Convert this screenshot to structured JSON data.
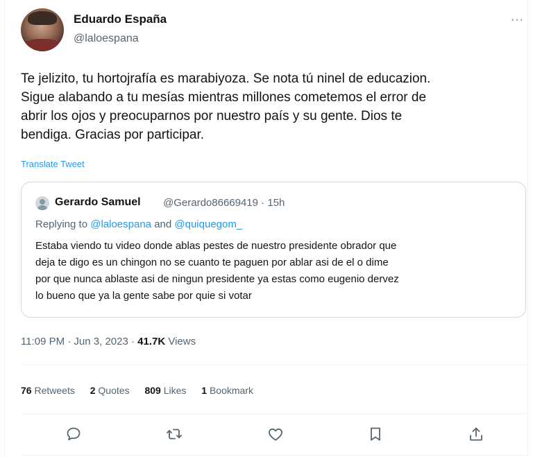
{
  "author": {
    "name": "Eduardo España",
    "handle": "@laloespana",
    "more_label": "···"
  },
  "tweet": {
    "lines": [
      "Te jelizito, tu hortojrafía es marabiyoza. Se nota tú ninel de educazion.",
      "Sigue alabando a tu mesías mientras millones cometemos el error de",
      "abrir los ojos y preocuparnos por nuestro país y su gente. Dios te",
      "bendiga. Gracias por participar."
    ],
    "translate_label": "Translate Tweet"
  },
  "quote": {
    "name": "Gerardo Samuel",
    "meta": "@Gerardo86669419 · 15h",
    "replying_prefix": "Replying to",
    "mention1": "@laloespana",
    "and": "and",
    "mention2": "@quiquegom_",
    "lines": [
      "Estaba viendo tu video donde ablas pestes de nuestro presidente obrador que",
      "deja te digo es un chingon no se cuanto te paguen por ablar asi de el o dime",
      "por que nunca ablaste asi de ningun presidente ya estas como eugenio dervez",
      "lo bueno que ya la gente sabe por quie  si votar"
    ]
  },
  "meta": {
    "time_date": "11:09 PM · Jun 3, 2023 · ",
    "views_count": "41.7K",
    "views_label": "Views"
  },
  "stats": {
    "retweets_count": "76",
    "retweets_label": "Retweets",
    "quotes_count": "2",
    "quotes_label": "Quotes",
    "likes_count": "809",
    "likes_label": "Likes",
    "bookmarks_count": "1",
    "bookmarks_label": "Bookmark"
  },
  "actions": [
    "reply-icon",
    "retweet-icon",
    "like-icon",
    "bookmark-icon",
    "share-icon"
  ],
  "colors": {
    "text": "#0f1419",
    "secondary": "#536471",
    "link": "#1d9bf0",
    "border": "#cfd9de",
    "divider": "#eff3f4"
  }
}
